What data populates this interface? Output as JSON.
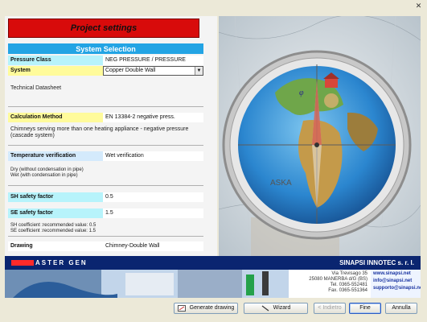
{
  "window": {
    "close_glyph": "✕"
  },
  "left_panel": {
    "title": "Project settings",
    "section_header": "System Selection",
    "pressure_class": {
      "label": "Pressure Class",
      "value": "NEG PRESSURE / PRESSURE"
    },
    "system": {
      "label": "System",
      "value": "Copper Double Wall"
    },
    "technical_datasheet": "Technical Datasheet",
    "calculation_method": {
      "label": "Calculation Method",
      "value": "EN 13384-2 negative press."
    },
    "calc_description_1": "Chimneys serving more than one heating appliance - negative pressure",
    "calc_description_2": "(cascade system)",
    "temperature_verification": {
      "label": "Temperature verification",
      "value": "Wet verification"
    },
    "temp_note_1": "Dry (without condensation in pipe)",
    "temp_note_2": "Wet (with condensation in pipe)",
    "sh_safety": {
      "label": "SH safety factor",
      "value": "0.5"
    },
    "se_safety": {
      "label": "SE safety factor",
      "value": "1.5"
    },
    "coef_note_1": "SH coefficient :recommended value: 0.5",
    "coef_note_2": "SE coefficient :recommended value: 1.5",
    "drawing": {
      "label": "Drawing",
      "value": "Chimney-Double Wall"
    }
  },
  "banner": {
    "left_brand": "ASTER GEN",
    "right_brand": "SINAPSI INNOTEC s. r. l.",
    "address": [
      "Via Trevisago 35",
      "25080 MANERBA d/G (BS)",
      "Tel. 0365-552481",
      "Fax. 0365-551364"
    ],
    "web": [
      "www.sinapsi.net",
      "info@sinapsi.net",
      "supporto@sinapsi.net"
    ]
  },
  "footer": {
    "generate_drawing": "Generate drawing",
    "wizard": "Wizard",
    "back": "< Indietro",
    "finish": "Fine",
    "cancel": "Annulla"
  },
  "colors": {
    "title_red": "#d80b0b",
    "section_blue": "#23a4e4",
    "label_cyan": "#b7f3fb",
    "label_yellow": "#fffb9b",
    "banner_navy": "#0d2d85"
  },
  "icons": [
    "close-icon",
    "dropdown-arrow-icon",
    "compass-globe-image",
    "drawing-icon",
    "wizard-icon"
  ]
}
